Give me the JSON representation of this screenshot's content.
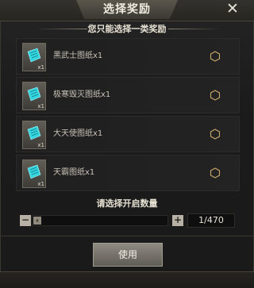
{
  "dialog": {
    "title": "选择奖励",
    "subtitle": "您只能选择一类奖励",
    "close_icon": "close-icon"
  },
  "options": [
    {
      "label": "黑武士图纸x1",
      "count": "x1",
      "icon": "blueprint-scroll-icon"
    },
    {
      "label": "极寒毁灭图纸x1",
      "count": "x1",
      "icon": "blueprint-scroll-icon"
    },
    {
      "label": "大天使图纸x1",
      "count": "x1",
      "icon": "blueprint-scroll-icon"
    },
    {
      "label": "天霸图纸x1",
      "count": "x1",
      "icon": "blueprint-scroll-icon"
    }
  ],
  "quantity": {
    "label": "请选择开启数量",
    "minus": "−",
    "plus": "+",
    "handle": "⏸",
    "value_text": "1/470",
    "current": 1,
    "max": 470
  },
  "use_button": "使用",
  "colors": {
    "scroll_cyan": "#34d6e0",
    "background": "#1a1a1b"
  }
}
